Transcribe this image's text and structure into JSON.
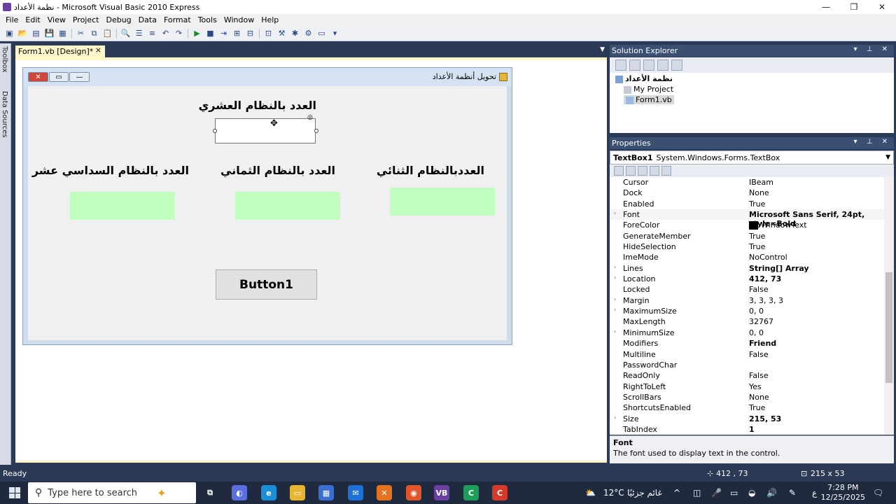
{
  "window": {
    "title": "نظمة الأعداد - Microsoft Visual Basic 2010 Express"
  },
  "menu": [
    "File",
    "Edit",
    "View",
    "Project",
    "Debug",
    "Data",
    "Format",
    "Tools",
    "Window",
    "Help"
  ],
  "rail": {
    "toolbox": "Toolbox",
    "data_sources": "Data Sources"
  },
  "doc_tab": {
    "label": "Form1.vb [Design]*",
    "close": "×"
  },
  "form": {
    "title": "تحويل أنظمة الأعداد",
    "label_decimal": "العدد بالنظام العشري",
    "label_binary": "العددبالنظام الثنائي",
    "label_octal": "العدد بالنظام الثماني",
    "label_hex": "العدد بالنظام السداسي عشر",
    "button1": "Button1",
    "colors": {
      "green_box": "#c0ffc0"
    }
  },
  "solution_explorer": {
    "title": "Solution Explorer",
    "items": [
      "نظمة الأعداد",
      "My Project",
      "Form1.vb"
    ]
  },
  "properties": {
    "title": "Properties",
    "object_name": "TextBox1",
    "object_type": "System.Windows.Forms.TextBox",
    "rows": [
      {
        "name": "Cursor",
        "value": "IBeam",
        "expand": false,
        "bold": false
      },
      {
        "name": "Dock",
        "value": "None",
        "expand": false,
        "bold": false
      },
      {
        "name": "Enabled",
        "value": "True",
        "expand": false,
        "bold": false
      },
      {
        "name": "Font",
        "value": "Microsoft Sans Serif, 24pt, style=Bold",
        "expand": true,
        "bold": true
      },
      {
        "name": "ForeColor",
        "value": "WindowText",
        "expand": false,
        "bold": false,
        "swatch": true
      },
      {
        "name": "GenerateMember",
        "value": "True",
        "expand": false,
        "bold": false
      },
      {
        "name": "HideSelection",
        "value": "True",
        "expand": false,
        "bold": false
      },
      {
        "name": "ImeMode",
        "value": "NoControl",
        "expand": false,
        "bold": false
      },
      {
        "name": "Lines",
        "value": "String[] Array",
        "expand": true,
        "bold": true
      },
      {
        "name": "Location",
        "value": "412, 73",
        "expand": true,
        "bold": true
      },
      {
        "name": "Locked",
        "value": "False",
        "expand": false,
        "bold": false
      },
      {
        "name": "Margin",
        "value": "3, 3, 3, 3",
        "expand": true,
        "bold": false
      },
      {
        "name": "MaximumSize",
        "value": "0, 0",
        "expand": true,
        "bold": false
      },
      {
        "name": "MaxLength",
        "value": "32767",
        "expand": false,
        "bold": false
      },
      {
        "name": "MinimumSize",
        "value": "0, 0",
        "expand": true,
        "bold": false
      },
      {
        "name": "Modifiers",
        "value": "Friend",
        "expand": false,
        "bold": true
      },
      {
        "name": "Multiline",
        "value": "False",
        "expand": false,
        "bold": false
      },
      {
        "name": "PasswordChar",
        "value": "",
        "expand": false,
        "bold": false
      },
      {
        "name": "ReadOnly",
        "value": "False",
        "expand": false,
        "bold": false
      },
      {
        "name": "RightToLeft",
        "value": "Yes",
        "expand": false,
        "bold": false
      },
      {
        "name": "ScrollBars",
        "value": "None",
        "expand": false,
        "bold": false
      },
      {
        "name": "ShortcutsEnabled",
        "value": "True",
        "expand": false,
        "bold": false
      },
      {
        "name": "Size",
        "value": "215, 53",
        "expand": true,
        "bold": true
      },
      {
        "name": "TabIndex",
        "value": "1",
        "expand": false,
        "bold": true
      }
    ],
    "description_title": "Font",
    "description_text": "The font used to display text in the control."
  },
  "status": {
    "text": "Ready",
    "location": "412 , 73",
    "size": "215 x 53"
  },
  "taskbar": {
    "search_placeholder": "Type here to search",
    "weather": "12°C",
    "weather_text": "غائم جزئيًا",
    "lang": "ع",
    "time": "7:28 PM",
    "date": "12/25/2025"
  }
}
